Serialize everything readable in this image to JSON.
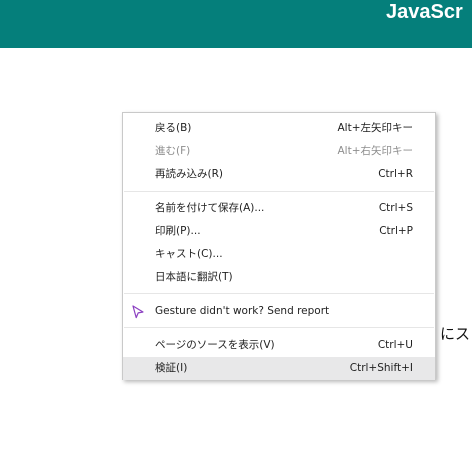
{
  "header": {
    "title": "JavaScr",
    "background_color": "#057f7b"
  },
  "background_text": "にス",
  "context_menu": {
    "items": [
      {
        "label": "戻る(B)",
        "shortcut": "Alt+左矢印キー",
        "disabled": false
      },
      {
        "label": "進む(F)",
        "shortcut": "Alt+右矢印キー",
        "disabled": true
      },
      {
        "label": "再読み込み(R)",
        "shortcut": "Ctrl+R",
        "disabled": false
      },
      {
        "label": "名前を付けて保存(A)...",
        "shortcut": "Ctrl+S",
        "disabled": false
      },
      {
        "label": "印刷(P)...",
        "shortcut": "Ctrl+P",
        "disabled": false
      },
      {
        "label": "キャスト(C)...",
        "shortcut": "",
        "disabled": false
      },
      {
        "label": "日本語に翻訳(T)",
        "shortcut": "",
        "disabled": false
      },
      {
        "label": "Gesture didn't work? Send report",
        "shortcut": "",
        "disabled": false,
        "icon": "gesture-cursor-icon"
      },
      {
        "label": "ページのソースを表示(V)",
        "shortcut": "Ctrl+U",
        "disabled": false
      },
      {
        "label": "検証(I)",
        "shortcut": "Ctrl+Shift+I",
        "disabled": false,
        "highlighted": true
      }
    ],
    "highlight_color": "#e8e8e9",
    "icon_color": "#8b3fc1"
  }
}
